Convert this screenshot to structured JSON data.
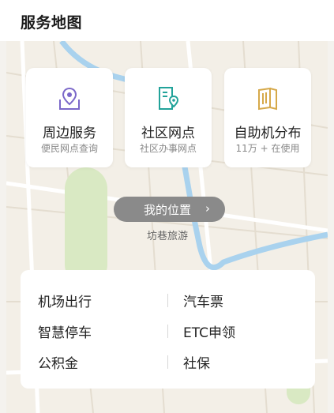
{
  "header": {
    "title": "服务地图"
  },
  "cards": [
    {
      "title": "周边服务",
      "subtitle": "便民网点查询",
      "icon": "location-map-icon",
      "color": "#7b68c9"
    },
    {
      "title": "社区网点",
      "subtitle": "社区办事网点",
      "icon": "building-location-icon",
      "color": "#22a39a"
    },
    {
      "title": "自助机分布",
      "subtitle": "11万 + 在使用",
      "icon": "kiosk-book-icon",
      "color": "#d6a94a"
    }
  ],
  "location_button": {
    "label": "我的位置",
    "icon": "chevron-right-icon"
  },
  "map_label": "坊巷旅游",
  "quick_links": [
    {
      "label": "机场出行"
    },
    {
      "label": "汽车票"
    },
    {
      "label": "智慧停车"
    },
    {
      "label": "ETC申领"
    },
    {
      "label": "公积金"
    },
    {
      "label": "社保"
    }
  ]
}
